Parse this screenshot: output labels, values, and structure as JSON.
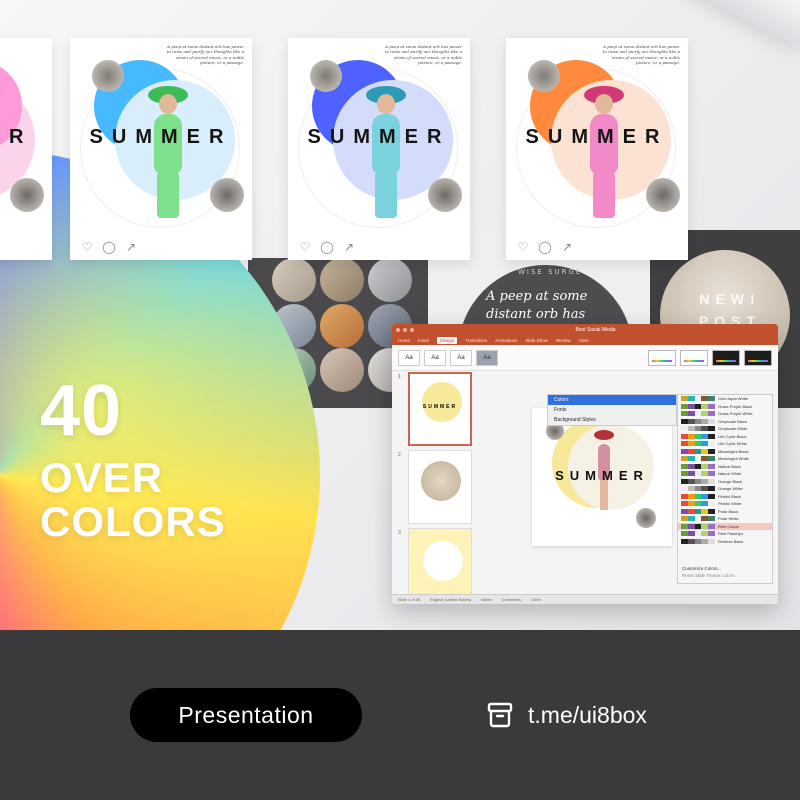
{
  "hero": {
    "headline_number": "40",
    "headline_line2": "OVER",
    "headline_line3": "COLORS"
  },
  "cards": [
    {
      "word": "SUMMER",
      "accent": "#46b9ff",
      "circle": "#d8eefc",
      "outfit": "#7fe08c",
      "hat": "#3dbb57"
    },
    {
      "word": "SUMMER",
      "accent": "#4d62ff",
      "circle": "#d4dcfb",
      "outfit": "#7ad2df",
      "hat": "#2e9bb5"
    },
    {
      "word": "SUMMER",
      "accent": "#ff8a3d",
      "circle": "#fbe2d3",
      "outfit": "#f28ac7",
      "hat": "#d23873"
    }
  ],
  "card_blurb": "A peep at some distant orb has power to raise and purify our thoughts like a strain of sacred music, or a noble picture, or a passage.",
  "card_actions": [
    "heart-icon",
    "comment-icon",
    "share-icon"
  ],
  "quote_slide": {
    "label": "WISE SURGE",
    "quote": "A peep at some distant orb has power to raise"
  },
  "new_slide": {
    "text": "NEW! POST BOOK"
  },
  "ppt": {
    "title": "Best Social Media",
    "tabs": [
      "Home",
      "Insert",
      "Design",
      "Transitions",
      "Animations",
      "Slide Show",
      "Review",
      "View"
    ],
    "active_tab": "Design",
    "theme_label": "Aa",
    "slide_numbers": [
      "1",
      "2",
      "3"
    ],
    "canvas_word": "SUMMER",
    "menu_items": [
      "Colors",
      "Fonts",
      "Background Styles"
    ],
    "palette_rows": [
      "Gold Aqua White",
      "Grass Purple Black",
      "Grass Purple White",
      "Greyscale Black",
      "Greyscale White",
      "Life Cycle Black",
      "Life Cycle White",
      "Meaningful Black",
      "Meaningful White",
      "Nature Black",
      "Nature White",
      "Orange Black",
      "Orange White",
      "Pinkful Black",
      "Pinkful White",
      "Polar Black",
      "Polar White",
      "Reel Colors",
      "Reel Pastelya",
      "Redless Black"
    ],
    "palette_highlight": "Reel Colors",
    "palette_footer": [
      "Customize Colors...",
      "Reset Slide Theme Colors"
    ],
    "status": [
      "Slide 1 of 36",
      "English (United States)",
      "Notes",
      "Comments",
      "110%"
    ]
  },
  "bottom": {
    "pill_label": "Presentation",
    "link_text": "t.me/ui8box",
    "link_icon": "archive-box-icon"
  },
  "colors": {
    "bottom_bar": "#3a3a3c",
    "pill": "#000000",
    "ppt_brand": "#c1512e"
  }
}
